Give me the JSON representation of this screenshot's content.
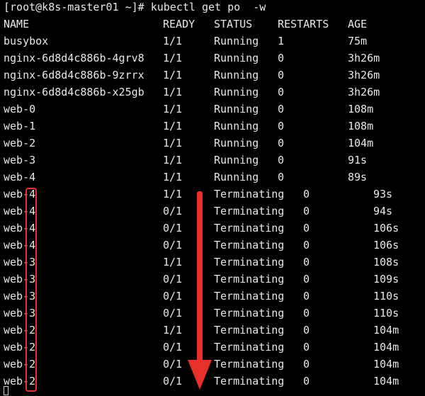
{
  "terminal": {
    "prompt": "[root@k8s-master01 ~]# kubectl get po  -w",
    "header": {
      "name": "NAME",
      "ready": "READY",
      "status": "STATUS",
      "restarts": "RESTARTS",
      "age": "AGE"
    },
    "initial_rows": [
      {
        "name": "busybox",
        "ready": "1/1",
        "status": "Running",
        "restarts": "1",
        "age": "75m"
      },
      {
        "name": "nginx-6d8d4c886b-4grv8",
        "ready": "1/1",
        "status": "Running",
        "restarts": "0",
        "age": "3h26m"
      },
      {
        "name": "nginx-6d8d4c886b-9zrrx",
        "ready": "1/1",
        "status": "Running",
        "restarts": "0",
        "age": "3h26m"
      },
      {
        "name": "nginx-6d8d4c886b-x25gb",
        "ready": "1/1",
        "status": "Running",
        "restarts": "0",
        "age": "3h26m"
      },
      {
        "name": "web-0",
        "ready": "1/1",
        "status": "Running",
        "restarts": "0",
        "age": "108m"
      },
      {
        "name": "web-1",
        "ready": "1/1",
        "status": "Running",
        "restarts": "0",
        "age": "108m"
      },
      {
        "name": "web-2",
        "ready": "1/1",
        "status": "Running",
        "restarts": "0",
        "age": "104m"
      },
      {
        "name": "web-3",
        "ready": "1/1",
        "status": "Running",
        "restarts": "0",
        "age": "91s"
      },
      {
        "name": "web-4",
        "ready": "1/1",
        "status": "Running",
        "restarts": "0",
        "age": "89s"
      }
    ],
    "watch_rows": [
      {
        "name": "web-4",
        "ready": "1/1",
        "status": "Terminating",
        "restarts": "0",
        "age": "93s"
      },
      {
        "name": "web-4",
        "ready": "0/1",
        "status": "Terminating",
        "restarts": "0",
        "age": "94s"
      },
      {
        "name": "web-4",
        "ready": "0/1",
        "status": "Terminating",
        "restarts": "0",
        "age": "106s"
      },
      {
        "name": "web-4",
        "ready": "0/1",
        "status": "Terminating",
        "restarts": "0",
        "age": "106s"
      },
      {
        "name": "web-3",
        "ready": "1/1",
        "status": "Terminating",
        "restarts": "0",
        "age": "108s"
      },
      {
        "name": "web-3",
        "ready": "0/1",
        "status": "Terminating",
        "restarts": "0",
        "age": "109s"
      },
      {
        "name": "web-3",
        "ready": "0/1",
        "status": "Terminating",
        "restarts": "0",
        "age": "110s"
      },
      {
        "name": "web-3",
        "ready": "0/1",
        "status": "Terminating",
        "restarts": "0",
        "age": "110s"
      },
      {
        "name": "web-2",
        "ready": "1/1",
        "status": "Terminating",
        "restarts": "0",
        "age": "104m"
      },
      {
        "name": "web-2",
        "ready": "0/1",
        "status": "Terminating",
        "restarts": "0",
        "age": "104m"
      },
      {
        "name": "web-2",
        "ready": "0/1",
        "status": "Terminating",
        "restarts": "0",
        "age": "104m"
      },
      {
        "name": "web-2",
        "ready": "0/1",
        "status": "Terminating",
        "restarts": "0",
        "age": "104m"
      }
    ]
  },
  "annotation": {
    "highlight_color": "#e8302a",
    "arrow_icon": "down-arrow-icon"
  },
  "colors": {
    "background": "#000000",
    "text": "#e8e8e8"
  }
}
